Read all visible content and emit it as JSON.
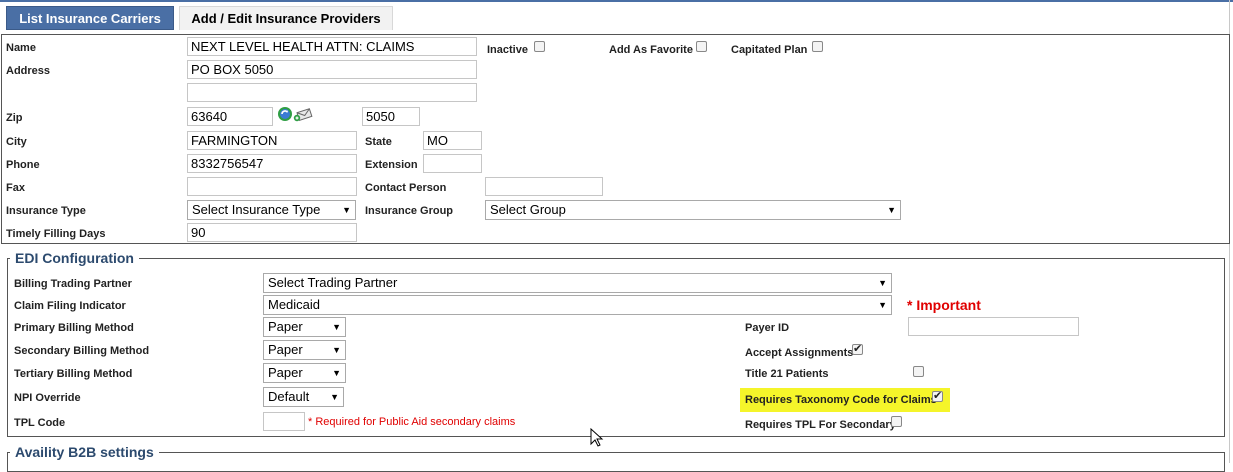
{
  "tabs": [
    {
      "label": "List Insurance Carriers"
    },
    {
      "label": "Add / Edit Insurance Providers"
    }
  ],
  "form": {
    "name": {
      "label": "Name",
      "value": "NEXT LEVEL HEALTH ATTN: CLAIMS"
    },
    "inactive_label": "Inactive",
    "favorite_label": "Add As Favorite",
    "capitated_label": "Capitated Plan",
    "address": {
      "label": "Address",
      "line1": "PO BOX 5050",
      "line2": ""
    },
    "zip": {
      "label": "Zip",
      "value": "63640",
      "ext": "5050"
    },
    "city": {
      "label": "City",
      "value": "FARMINGTON"
    },
    "state": {
      "label": "State",
      "value": "MO"
    },
    "phone": {
      "label": "Phone",
      "value": "8332756547"
    },
    "extension": {
      "label": "Extension",
      "value": ""
    },
    "fax": {
      "label": "Fax",
      "value": ""
    },
    "contact": {
      "label": "Contact Person",
      "value": ""
    },
    "insurance_type": {
      "label": "Insurance Type",
      "value": "Select Insurance Type"
    },
    "insurance_group": {
      "label": "Insurance Group",
      "value": "Select Group"
    },
    "timely": {
      "label": "Timely Filling Days",
      "value": "90"
    }
  },
  "edi": {
    "legend": "EDI Configuration",
    "trading_partner": {
      "label": "Billing Trading Partner",
      "value": "Select Trading Partner"
    },
    "claim_filing": {
      "label": "Claim Filing Indicator",
      "value": "Medicaid"
    },
    "important": "* Important",
    "primary": {
      "label": "Primary Billing Method",
      "value": "Paper"
    },
    "secondary": {
      "label": "Secondary Billing Method",
      "value": "Paper"
    },
    "tertiary": {
      "label": "Tertiary Billing Method",
      "value": "Paper"
    },
    "npi": {
      "label": "NPI Override",
      "value": "Default"
    },
    "tpl": {
      "label": "TPL Code",
      "value": "",
      "note": "* Required for Public Aid secondary claims"
    },
    "payer_id": {
      "label": "Payer ID",
      "value": ""
    },
    "accept_assignments": {
      "label": "Accept Assignments",
      "checked": true
    },
    "title21": {
      "label": "Title 21 Patients",
      "checked": false
    },
    "taxonomy": {
      "label": "Requires Taxonomy Code for Claims",
      "checked": true
    },
    "tpl_secondary": {
      "label": "Requires TPL For Secondary",
      "checked": false
    }
  },
  "availity": {
    "legend": "Availity B2B settings"
  },
  "colors": {
    "tab_active": "#4a6fa5",
    "legend": "#2c4a6e",
    "required": "#e00000",
    "highlight": "#f5f52a"
  }
}
